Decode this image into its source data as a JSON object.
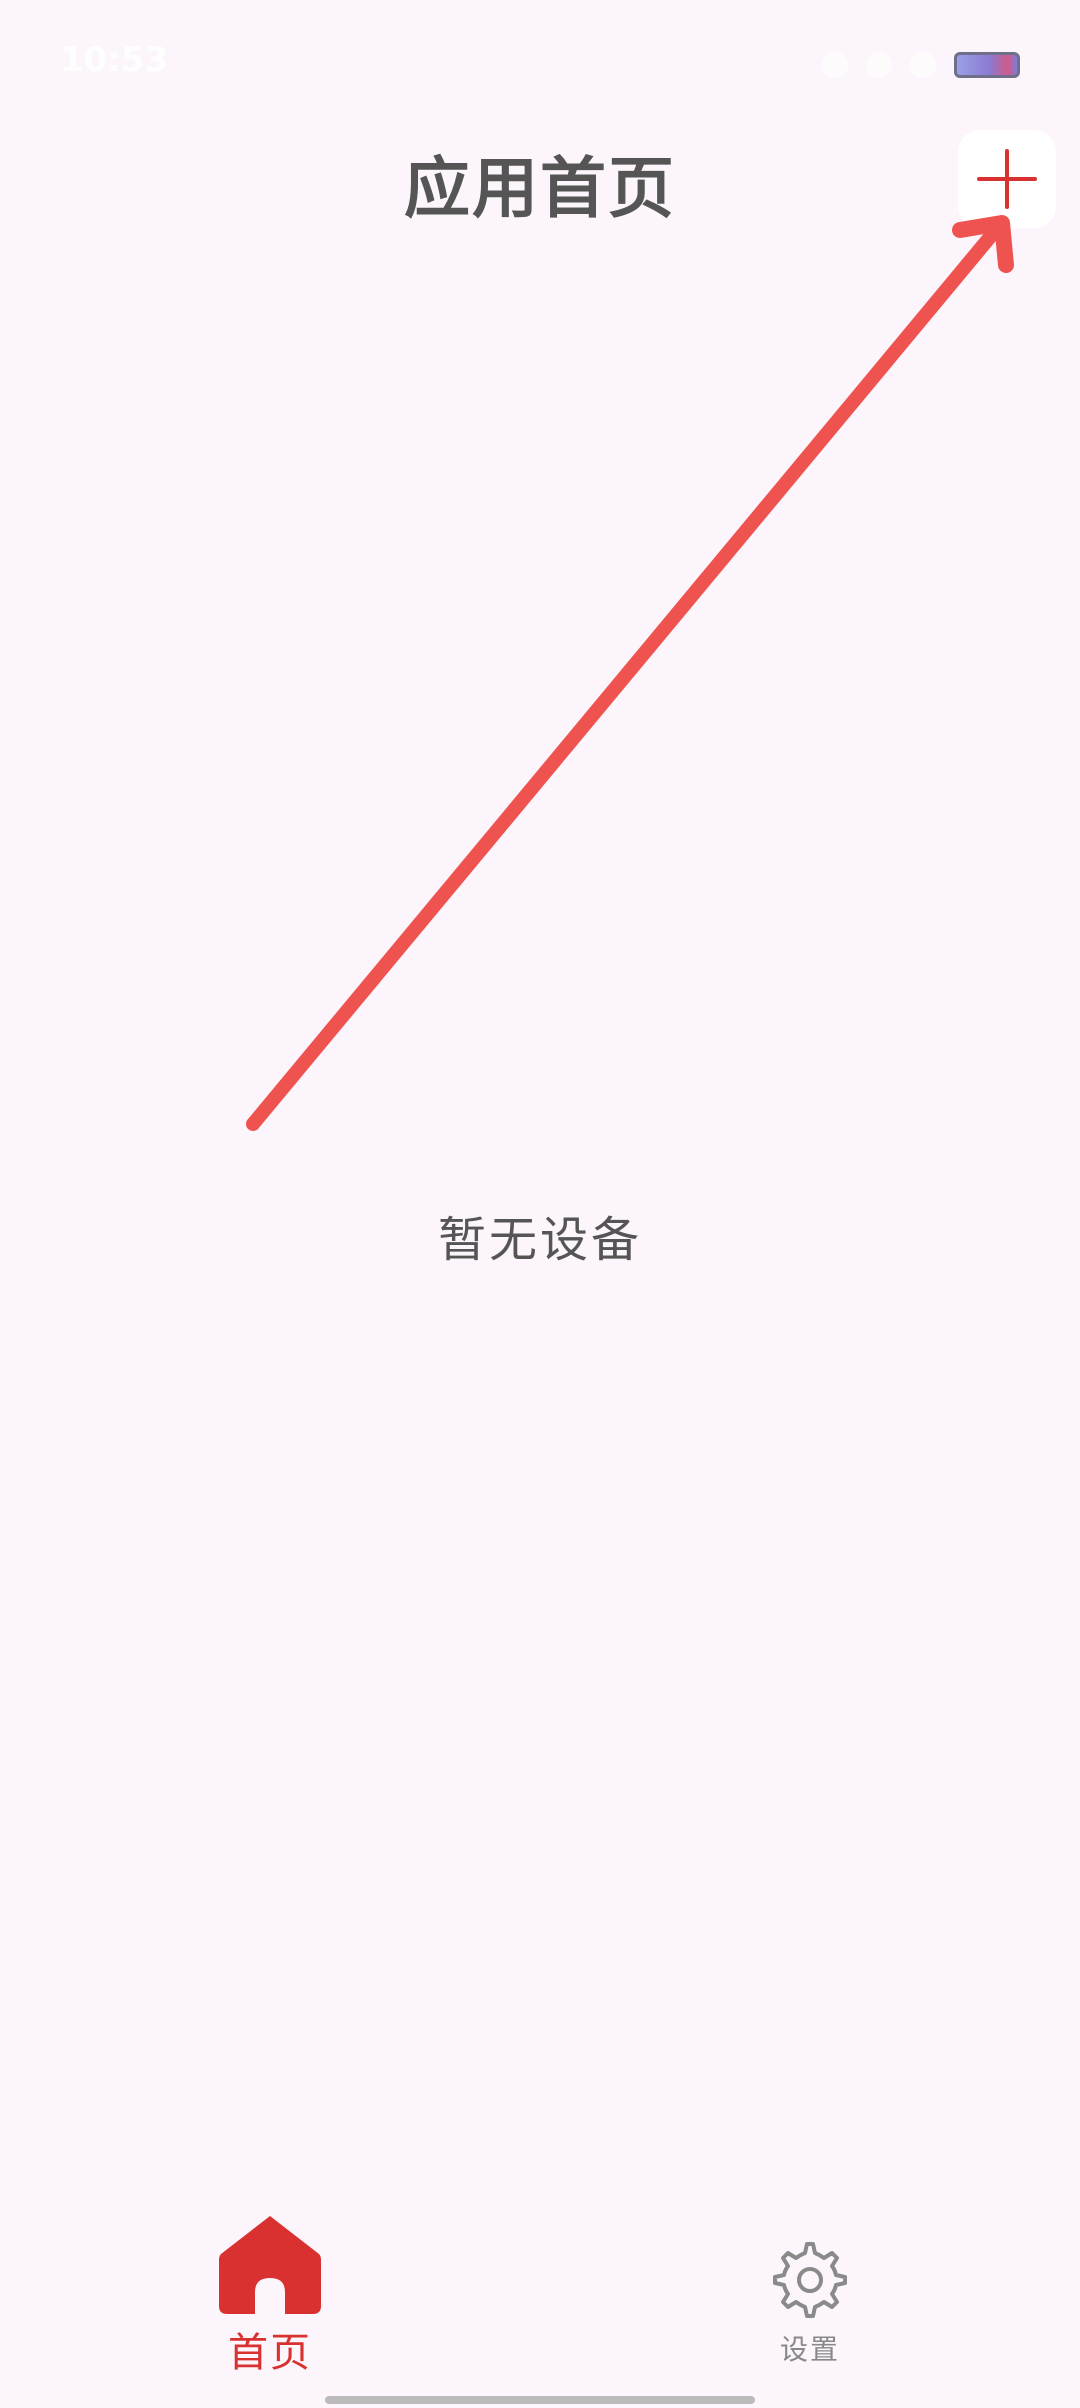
{
  "status_bar": {
    "time": "10:53"
  },
  "header": {
    "title": "应用首页",
    "add_button_icon": "plus-icon"
  },
  "main": {
    "empty_text": "暂无设备"
  },
  "bottom_nav": {
    "items": [
      {
        "label": "首页",
        "icon": "home-icon",
        "active": true
      },
      {
        "label": "设置",
        "icon": "gear-icon",
        "active": false
      }
    ]
  },
  "colors": {
    "accent": "#d93030",
    "background": "#fcf5fb",
    "annotation_arrow": "#ef5350"
  }
}
